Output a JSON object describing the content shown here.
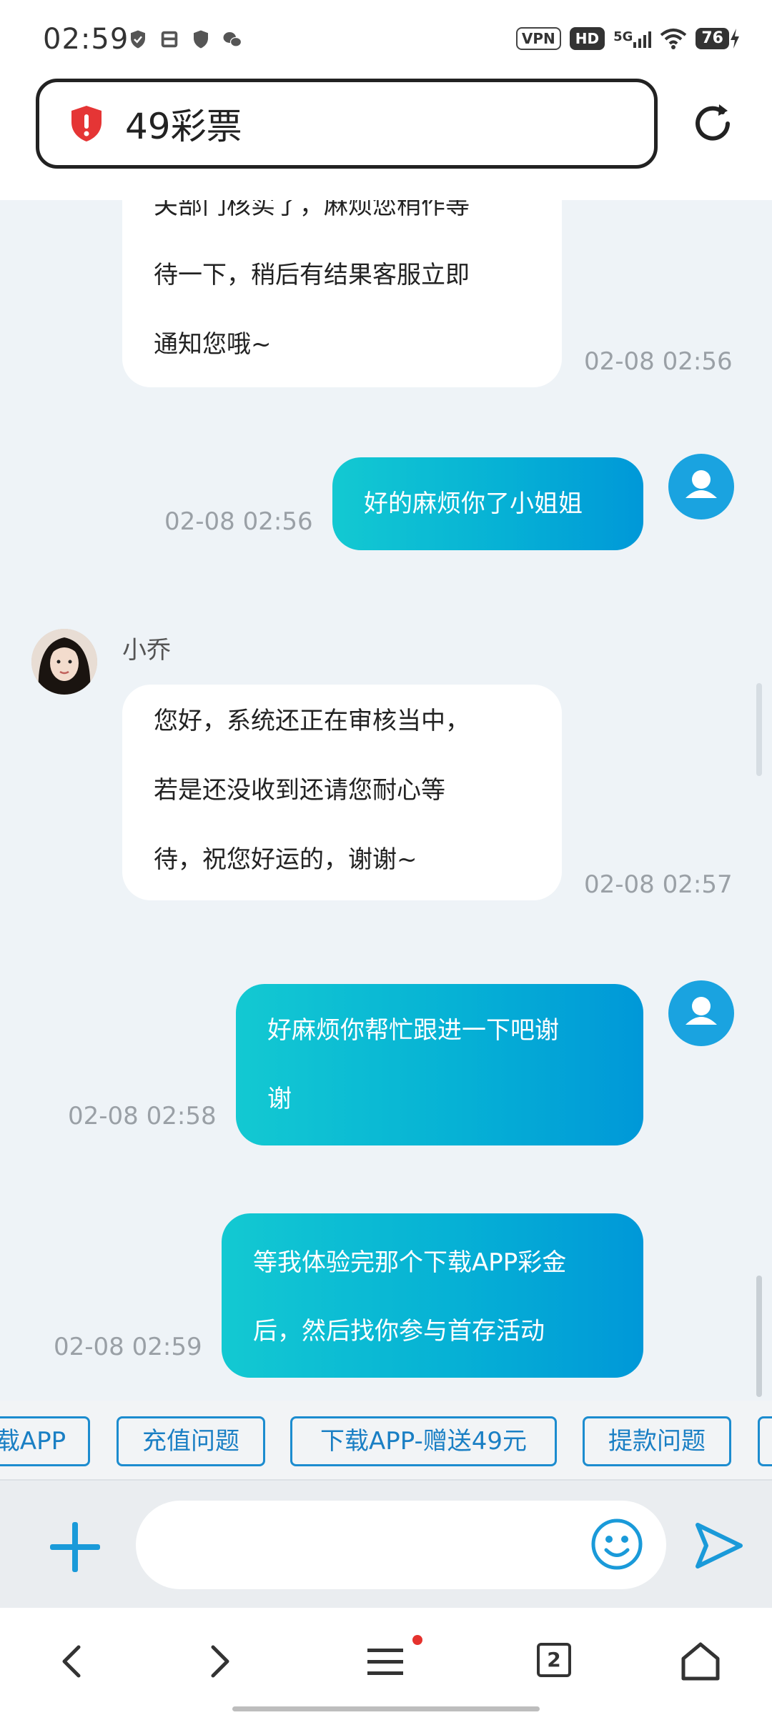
{
  "status_bar": {
    "time": "02:59",
    "vpn_label": "VPN",
    "hd_label": "HD",
    "network_label": "5G",
    "battery": "76"
  },
  "address_bar": {
    "title": "49彩票"
  },
  "chat": {
    "messages": [
      {
        "from": "agent",
        "lines": [
          "关部门核实了，麻烦您稍作等",
          "待一下，稍后有结果客服立即",
          "通知您哦~"
        ],
        "time": "02-08 02:56"
      },
      {
        "from": "user",
        "lines": [
          "好的麻烦你了小姐姐"
        ],
        "time": "02-08 02:56"
      },
      {
        "from": "agent",
        "name": "小乔",
        "lines": [
          "您好，系统还正在审核当中，",
          "若是还没收到还请您耐心等",
          "待，祝您好运的，谢谢~"
        ],
        "time": "02-08 02:57"
      },
      {
        "from": "user",
        "lines": [
          "好麻烦你帮忙跟进一下吧谢",
          "谢"
        ],
        "time": "02-08 02:58"
      },
      {
        "from": "user",
        "lines": [
          "等我体验完那个下载APP彩金",
          "后，然后找你参与首存活动"
        ],
        "time": "02-08 02:59"
      }
    ]
  },
  "quick_replies": [
    "载APP",
    "充值问题",
    "下载APP-赠送49元",
    "提款问题"
  ],
  "input": {
    "placeholder": ""
  },
  "nav": {
    "tab_count": "2"
  },
  "colors": {
    "accent": "#1aa3e0",
    "bubble_gradient_start": "#13c9d2",
    "bubble_gradient_end": "#0098d8",
    "chip_border": "#1c8ccf",
    "badge_red": "#e5322d"
  }
}
